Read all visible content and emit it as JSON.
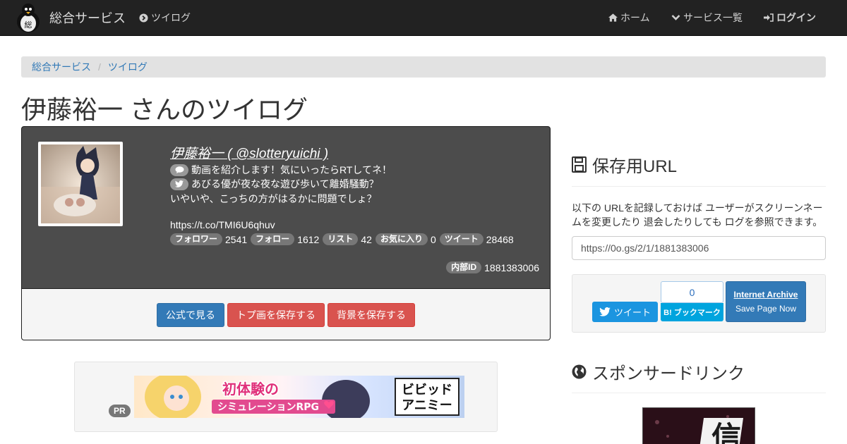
{
  "navbar": {
    "brand": "総合サービス",
    "tweetlog": "ツイログ",
    "home": "ホーム",
    "services": "サービス一覧",
    "login": "ログイン",
    "logo_char": "総"
  },
  "breadcrumb": {
    "items": [
      "総合サービス",
      "ツイログ"
    ],
    "separator": "/"
  },
  "page_title": "伊藤裕一 さんのツイログ",
  "profile": {
    "name": "伊藤裕一 ( @slotteryuichi )",
    "lines": [
      "動画を紹介します！気にいったらRTしてネ！",
      "あびる優が夜な夜な遊び歩いて離婚騒動？",
      "いやいや、こっちの方がはるかに問題でしょ？",
      "https://t.co/TMI6U6qhuv"
    ],
    "stats": [
      {
        "label": "フォロワー",
        "value": "2541"
      },
      {
        "label": "フォロー",
        "value": "1612"
      },
      {
        "label": "リスト",
        "value": "42"
      },
      {
        "label": "お気に入り",
        "value": "0"
      },
      {
        "label": "ツイート",
        "value": "28468"
      }
    ],
    "internal_id_label": "内部ID",
    "internal_id": "1881383006"
  },
  "actions": {
    "official": "公式で見る",
    "save_top": "トプ画を保存する",
    "save_bg": "背景を保存する"
  },
  "ad": {
    "pr_label": "PR",
    "banner_line1": "初体験の",
    "banner_line2": "シミュレーションRPG",
    "banner_logo_1": "ビビッド",
    "banner_logo_2": "アニミー"
  },
  "save_url": {
    "title": "保存用URL",
    "description": "以下の URLを記録しておけば ユーザーがスクリーンネームを変更したり 退会したりしても ログを参照できます。",
    "url": "https://0o.gs/2/1/1881383006"
  },
  "share": {
    "tweet": "ツイート",
    "hatena_count": "0",
    "hatena_label": "B! ブックマーク",
    "ia_title": "Internet Archive",
    "ia_sub": "Save Page Now"
  },
  "sponsor": {
    "title": "スポンサードリンク",
    "image_char": "信"
  },
  "colors": {
    "navbar": "#222222",
    "primary": "#337ab7",
    "danger": "#d9534f",
    "twitter": "#1b95e0",
    "hatena": "#00a4de"
  }
}
